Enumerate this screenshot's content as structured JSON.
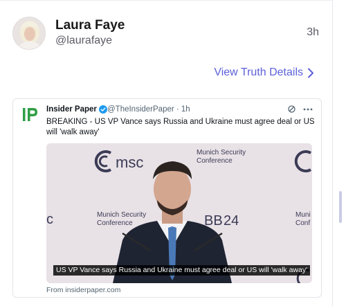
{
  "post": {
    "display_name": "Laura Faye",
    "handle": "@laurafaye",
    "timestamp": "3h",
    "details_link": "View Truth Details"
  },
  "embed": {
    "source_name": "Insider Paper",
    "source_handle": "@TheInsiderPaper · 1h",
    "logo_text": "IP",
    "text": "BREAKING - US VP Vance says Russia and Ukraine must agree deal or US will 'walk away'",
    "media": {
      "backdrop_logo": "msc",
      "conference_label_top": "Munich Security Conference",
      "conference_label_left": "Munich Security Conference",
      "edition_label": "24",
      "edge_label": "Muni Conf",
      "caption": "US VP Vance says Russia and Ukraine must agree deal or US will 'walk away'"
    },
    "from_link": "From insiderpaper.com"
  },
  "colors": {
    "accent": "#5b5fd8",
    "logo_green": "#2f9e44",
    "verified_blue": "#1d9bf0"
  },
  "icons": {
    "chevron": "chevron-right-icon",
    "verified": "verified-badge-icon",
    "share": "share-icon",
    "more": "more-icon"
  }
}
